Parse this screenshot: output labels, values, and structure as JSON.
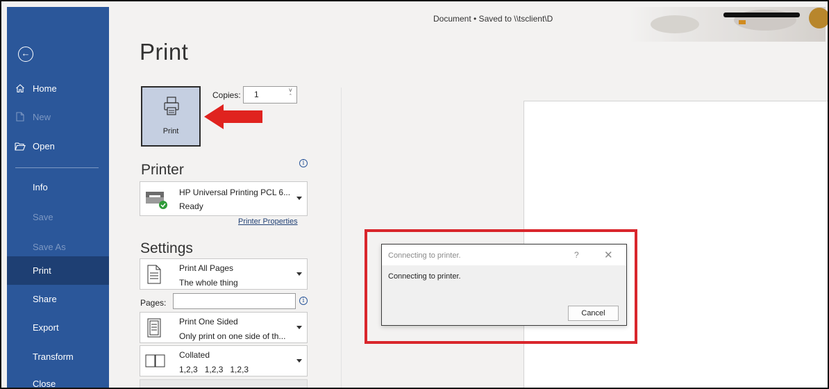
{
  "window": {
    "doc_title": "Document • Saved to \\\\tsclient\\D"
  },
  "sidebar": {
    "items": [
      {
        "label": "Home",
        "icon": "home-icon",
        "state": "normal"
      },
      {
        "label": "New",
        "icon": "new-doc-icon",
        "state": "disabled"
      },
      {
        "label": "Open",
        "icon": "folder-open-icon",
        "state": "normal"
      },
      {
        "label": "Info",
        "state": "normal"
      },
      {
        "label": "Save",
        "state": "disabled"
      },
      {
        "label": "Save As",
        "state": "disabled"
      },
      {
        "label": "Print",
        "state": "active"
      },
      {
        "label": "Share",
        "state": "normal"
      },
      {
        "label": "Export",
        "state": "normal"
      },
      {
        "label": "Transform",
        "state": "normal"
      },
      {
        "label": "Close",
        "state": "normal"
      }
    ]
  },
  "print": {
    "heading": "Print",
    "button_label": "Print",
    "copies_label": "Copies:",
    "copies_value": "1"
  },
  "printer": {
    "heading": "Printer",
    "name": "HP Universal Printing PCL 6...",
    "status": "Ready",
    "properties_link": "Printer Properties"
  },
  "settings": {
    "heading": "Settings",
    "range": {
      "title": "Print All Pages",
      "subtitle": "The whole thing"
    },
    "pages_label": "Pages:",
    "pages_value": "",
    "sides": {
      "title": "Print One Sided",
      "subtitle": "Only print on one side of th..."
    },
    "collation": {
      "title": "Collated",
      "subtitle": "1,2,3   1,2,3   1,2,3"
    }
  },
  "dialog": {
    "title": "Connecting to printer.",
    "message": "Connecting to printer.",
    "help": "?",
    "close": "✕",
    "cancel_label": "Cancel"
  },
  "colors": {
    "sidebar": "#2b579a",
    "sidebar_active": "#1e3f73",
    "highlight_red": "#d9262c",
    "print_button": "#c5cfe1"
  }
}
